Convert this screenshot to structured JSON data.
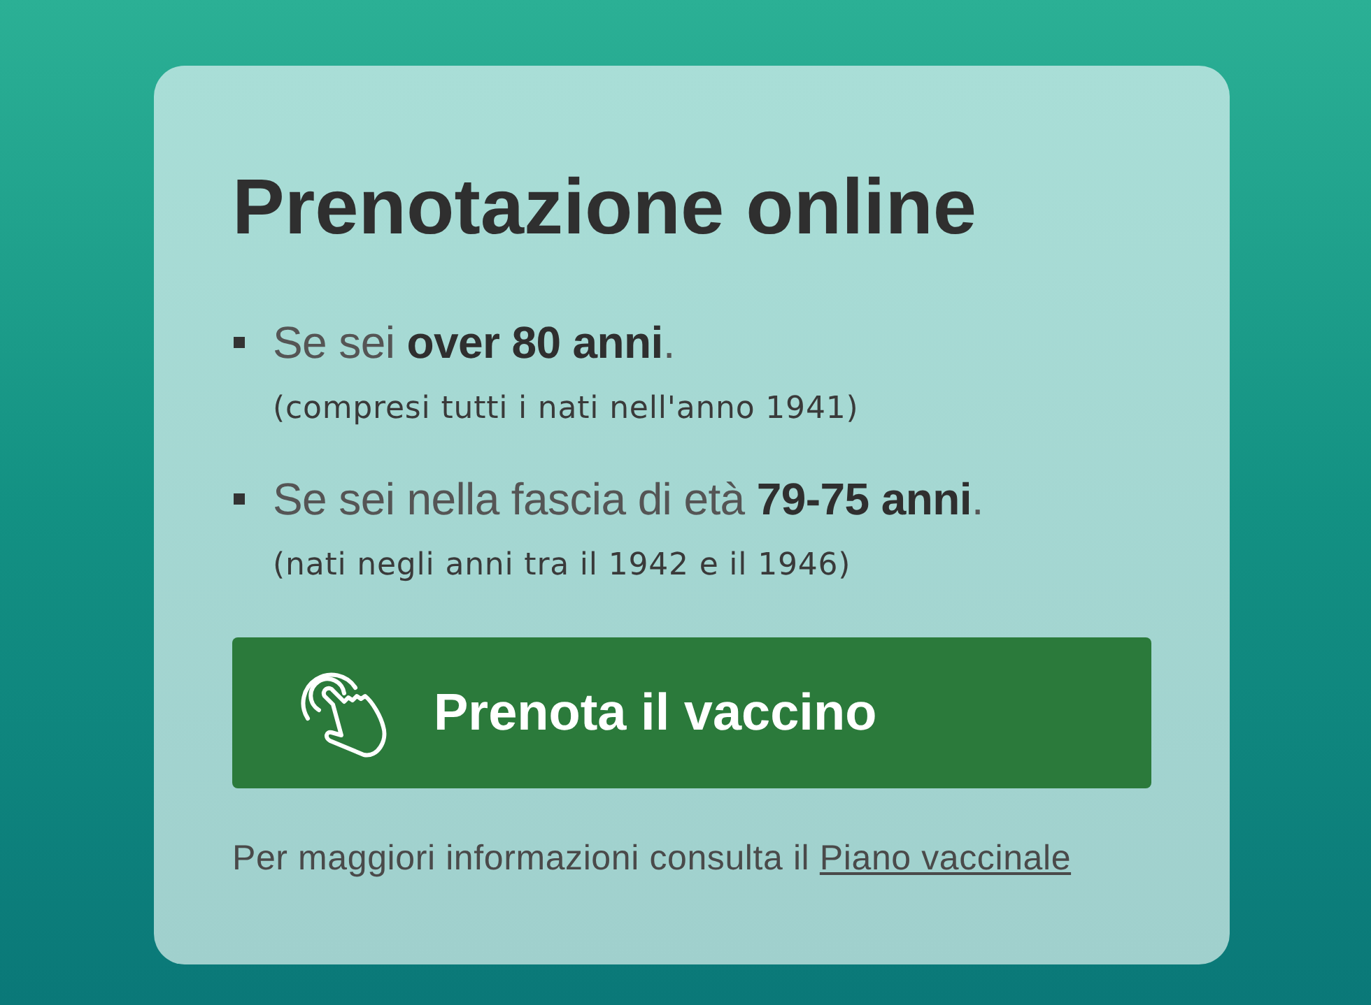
{
  "card": {
    "title": "Prenotazione online",
    "items": [
      {
        "text": "Se sei **over 80 anni**.",
        "note": "(compresi tutti i nati nell'anno 1941)"
      },
      {
        "text": "Se sei nella fascia di età **79-75 anni**.",
        "note": "(nati negli anni tra il 1942 e il 1946)"
      }
    ],
    "button": {
      "label": "Prenota il vaccino"
    },
    "footer": {
      "text": "Per maggiori informazioni consulta il",
      "link": "Piano vaccinale"
    }
  }
}
